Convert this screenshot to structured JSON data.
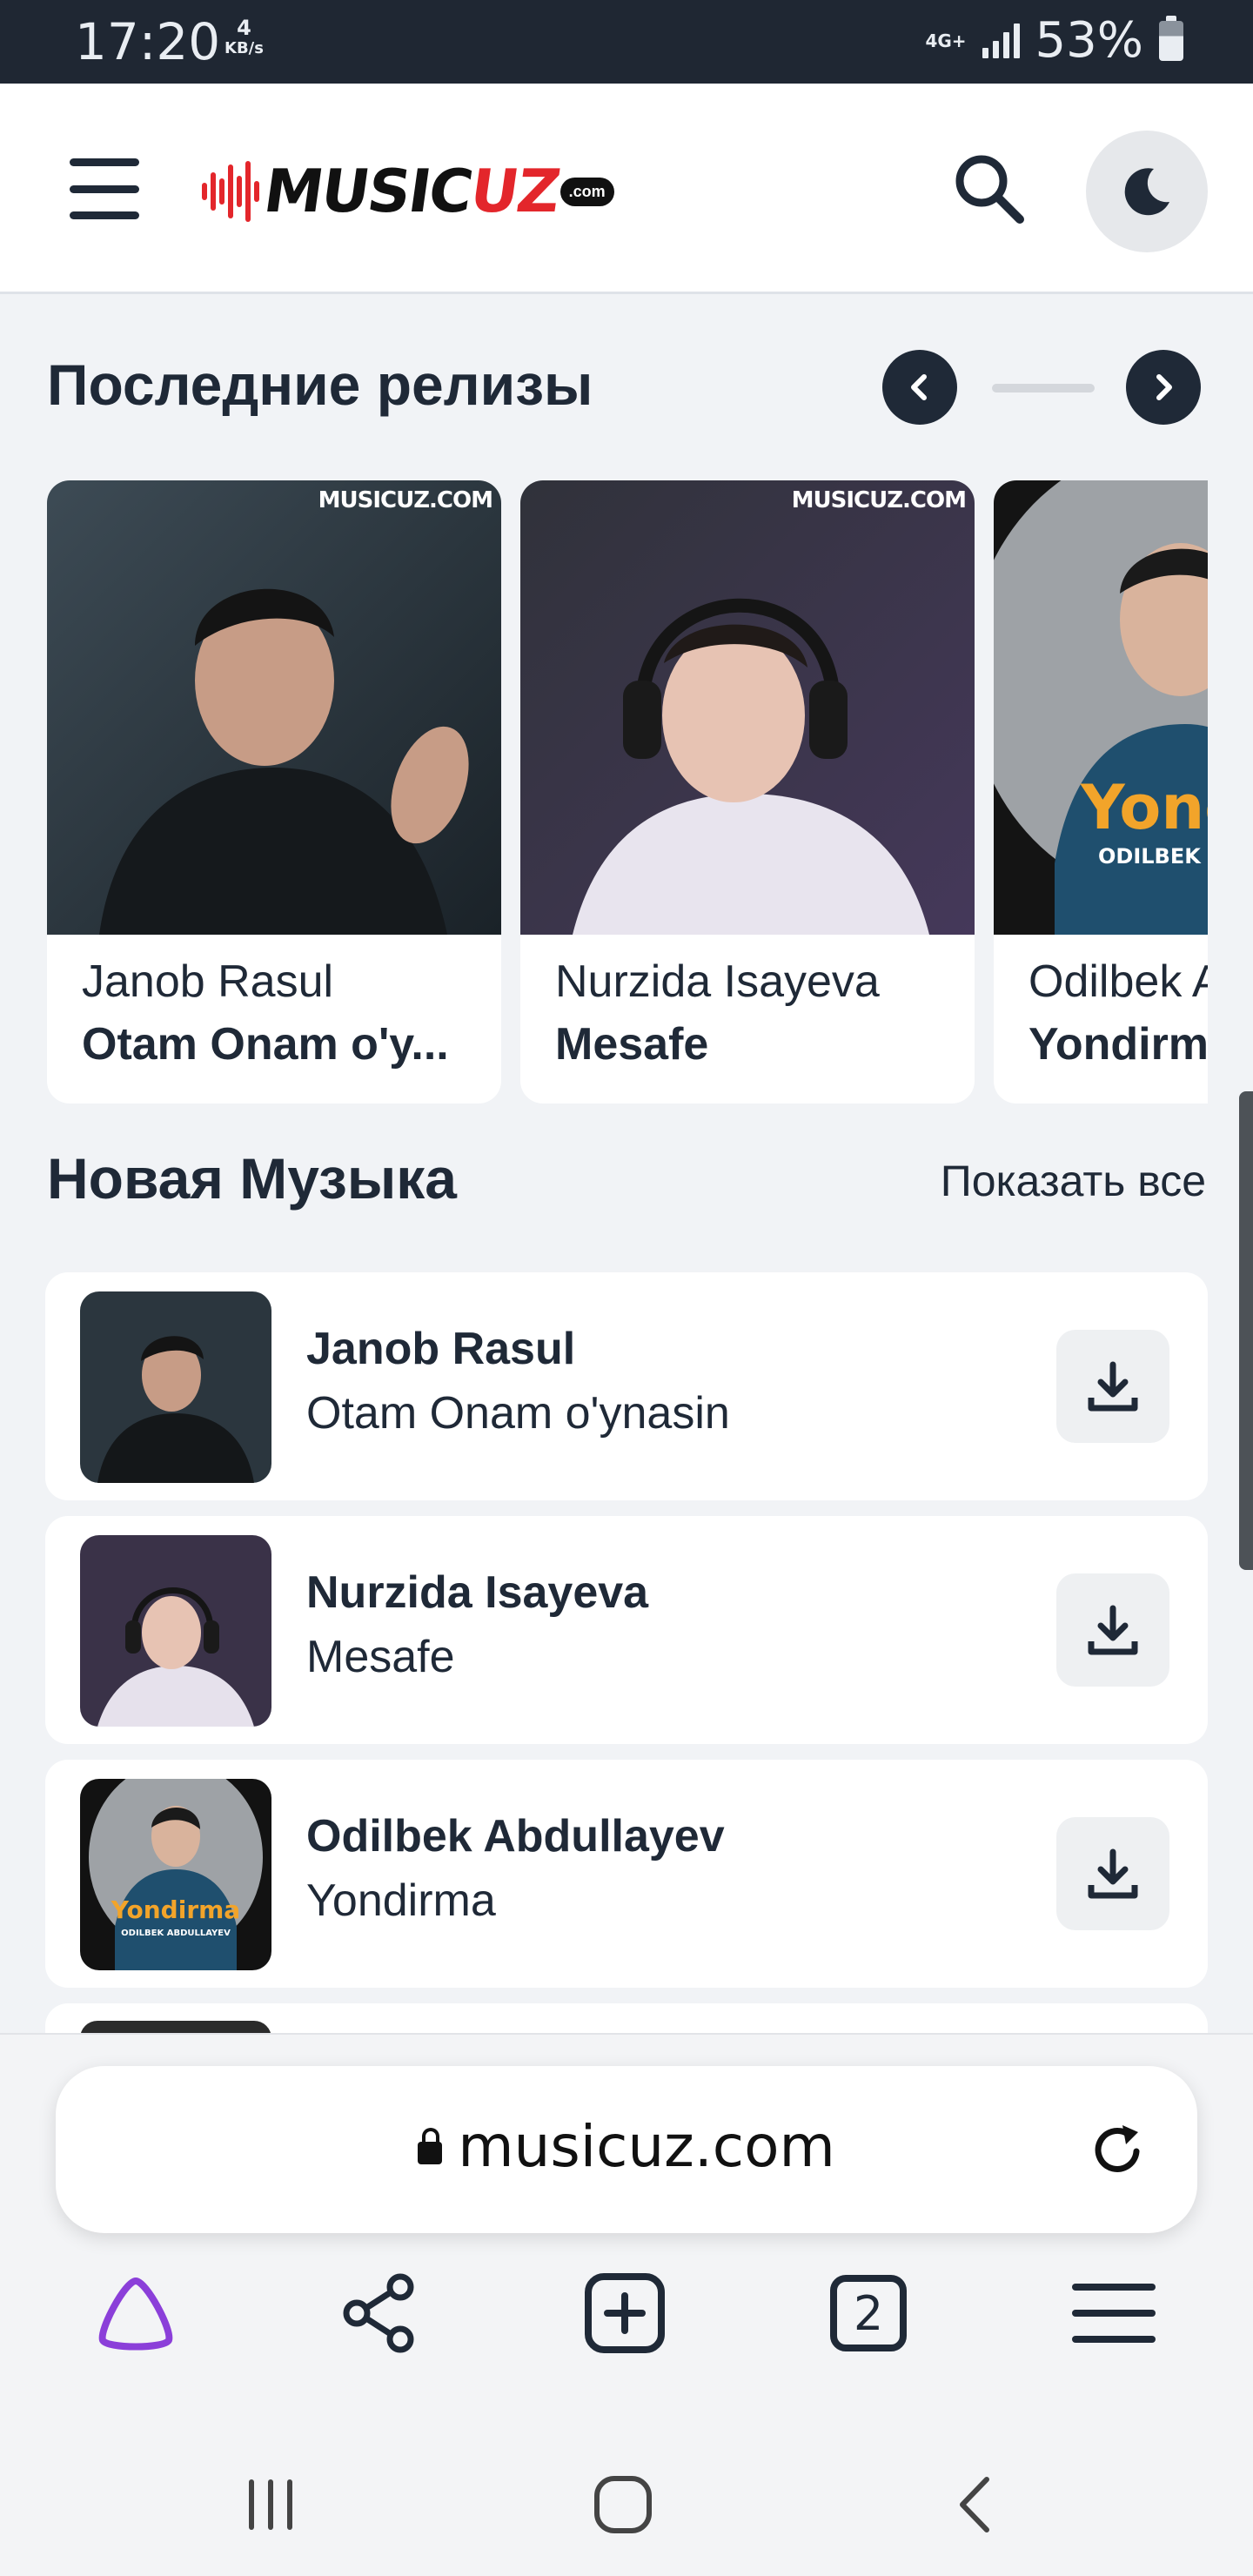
{
  "status_bar": {
    "time": "17:20",
    "speed_value": "4",
    "speed_unit": "KB/s",
    "network": "4G+",
    "battery": "53%"
  },
  "header": {
    "logo_text_left": "MUSIC",
    "logo_text_right": "UZ",
    "logo_suffix": ".com",
    "brand_color": "#e3262b"
  },
  "releases": {
    "title": "Последние релизы",
    "watermark": "MUSICUZ.COM",
    "items": [
      {
        "artist": "Janob Rasul",
        "song": "Otam Onam o'y..."
      },
      {
        "artist": "Nurzida Isayeva",
        "song": "Mesafe"
      },
      {
        "artist": "Odilbek A",
        "song": "Yondirm",
        "cover_text": "Yonc",
        "cover_subtext": "ODILBEK A"
      }
    ]
  },
  "new_music": {
    "title": "Новая Музыка",
    "show_all": "Показать все",
    "items": [
      {
        "artist": "Janob Rasul",
        "song": "Otam Onam o'ynasin"
      },
      {
        "artist": "Nurzida Isayeva",
        "song": "Mesafe"
      },
      {
        "artist": "Odilbek Abdullayev",
        "song": "Yondirma",
        "cover_text": "Yondirma",
        "cover_subtext": "ODILBEK ABDULLAYEV"
      }
    ]
  },
  "browser": {
    "url": "musicuz.com",
    "tab_count": "2",
    "accent": "#8b3fd9"
  }
}
